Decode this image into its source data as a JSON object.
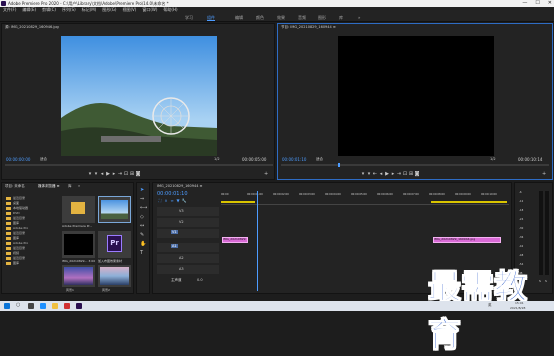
{
  "app": {
    "title": "Adobe Premiere Pro 2020 - C:\\用户\\Library\\文档\\Adobe\\Premiere Pro\\14.0\\未命名 *",
    "min": "—",
    "max": "☐",
    "close": "✕"
  },
  "menu": [
    "文件(F)",
    "编辑(E)",
    "剪辑(C)",
    "序列(S)",
    "标记(M)",
    "图形(G)",
    "视图(V)",
    "窗口(W)",
    "帮助(H)"
  ],
  "workspaces": [
    "学习",
    "组件",
    "编辑",
    "颜色",
    "效果",
    "音频",
    "图形",
    "库",
    "»"
  ],
  "source_monitor": {
    "tab": "源: IMG_20210829_160946.jpg",
    "timecode_left": "00:00:00:00",
    "fit": "适合",
    "fraction": "1/2",
    "timecode_right": "00:00:05:00"
  },
  "program_monitor": {
    "tab": "节目: IMG_20210829_160944 ≡",
    "timecode_left": "00:00:01:10",
    "fit": "适合",
    "fraction": "1/2",
    "timecode_right": "00:00:10:14"
  },
  "project": {
    "tabs": [
      "项目: 未命名",
      "媒体浏览器 ≡",
      "库",
      "»"
    ],
    "tree": [
      "最近目录",
      "桌面",
      "本地驱动器",
      "DVD",
      "最近目录",
      "图库",
      "Adobe Pro",
      "最近目录",
      "图库",
      "Adobe Pro",
      "最近目录",
      "视频",
      "最近目录",
      "图库"
    ],
    "tiles": [
      {
        "label": "Adobe Premiere Pr..."
      },
      {
        "label": "IMG_20210829..."
      },
      {
        "label": "IMG_20210829... 3:00"
      },
      {
        "label": "加入布图效果素材"
      },
      {
        "label": "风景1"
      },
      {
        "label": "风景2"
      }
    ],
    "pr_badge": "Pr"
  },
  "timeline": {
    "tab": "IMG_20210829_160944 ≡",
    "timecode": "00:00:01:10",
    "ruler": [
      "00:00",
      "00:00:01:00",
      "00:00:02:00",
      "00:00:03:00",
      "00:00:04:00",
      "00:00:05:00",
      "00:00:06:00",
      "00:00:07:00",
      "00:00:08:00",
      "00:00:09:00",
      "00:00:10:00"
    ],
    "tracks": [
      "V3",
      "V2",
      "V1",
      "A1",
      "A2",
      "A3"
    ],
    "master": "主声道",
    "master_value": "0.0",
    "clips": [
      {
        "label": "IMG_20210829"
      },
      {
        "label": "IMG_20210829_160944.jpg"
      }
    ]
  },
  "audio_meter": {
    "labels": [
      "-6",
      "-12",
      "-18",
      "-24",
      "-30",
      "-36",
      "-42",
      "-48",
      "-54",
      "dB"
    ],
    "s_labels": [
      "S",
      "S"
    ]
  },
  "taskbar": {
    "search": "○",
    "clock_time": "15:01",
    "clock_date": "2021/8/28",
    "lang": "英"
  },
  "watermark": "最需教育",
  "colors": {
    "accent": "#4d9cff",
    "clip": "#d96ad6",
    "playhead": "#4d9cff"
  }
}
